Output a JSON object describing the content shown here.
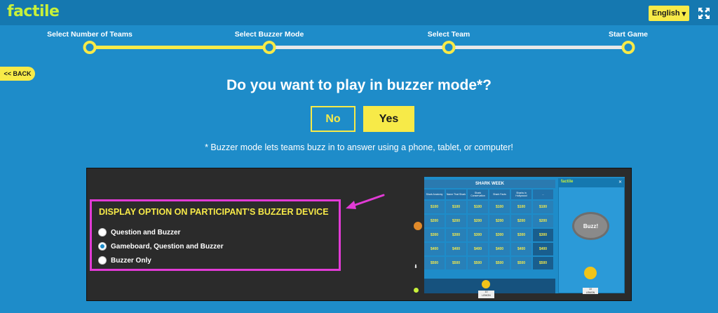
{
  "app": {
    "logo": "factile"
  },
  "header": {
    "language": "English",
    "language_caret": "▾"
  },
  "steps": [
    {
      "label": "Select Number of Teams"
    },
    {
      "label": "Select Buzzer Mode"
    },
    {
      "label": "Select Team"
    },
    {
      "label": "Start Game"
    }
  ],
  "back_label": "<< BACK",
  "question": "Do you want to play in buzzer mode*?",
  "buttons": {
    "no": "No",
    "yes": "Yes"
  },
  "note": "* Buzzer mode lets teams buzz in to answer using a phone, tablet, or computer!",
  "display_options": {
    "title": "DISPLAY OPTION ON PARTICIPANT'S BUZZER DEVICE",
    "options": [
      {
        "label": "Question and Buzzer",
        "selected": false
      },
      {
        "label": "Gameboard, Question and Buzzer",
        "selected": true
      },
      {
        "label": "Buzzer Only",
        "selected": false
      }
    ]
  },
  "preview": {
    "board_title": "SHARK WEEK",
    "categories": [
      "Shark Anatomy",
      "Name That Shark",
      "Shark Conservation",
      "Shark Facts",
      "Sharks in Hollywood",
      "..."
    ],
    "rows": [
      [
        "$100",
        "$100",
        "$100",
        "$100",
        "$100",
        "$100"
      ],
      [
        "$200",
        "$200",
        "$200",
        "$200",
        "$200",
        "$200"
      ],
      [
        "$300",
        "$300",
        "$300",
        "$300",
        "$300",
        "$300"
      ],
      [
        "$400",
        "$400",
        "$400",
        "$400",
        "$400",
        "$400"
      ],
      [
        "$500",
        "$500",
        "$500",
        "$500",
        "$500",
        "$500"
      ]
    ],
    "used_cells": [
      [
        2,
        5
      ],
      [
        3,
        5
      ],
      [
        4,
        5
      ]
    ],
    "team_score": "10",
    "team_name": "LEMON",
    "phone_logo": "factile",
    "phone_close": "✕",
    "buzz_label": "Buzz!"
  },
  "colors": {
    "accent": "#f7ea48",
    "background": "#1e8cc9",
    "highlight": "#e23bd6"
  }
}
